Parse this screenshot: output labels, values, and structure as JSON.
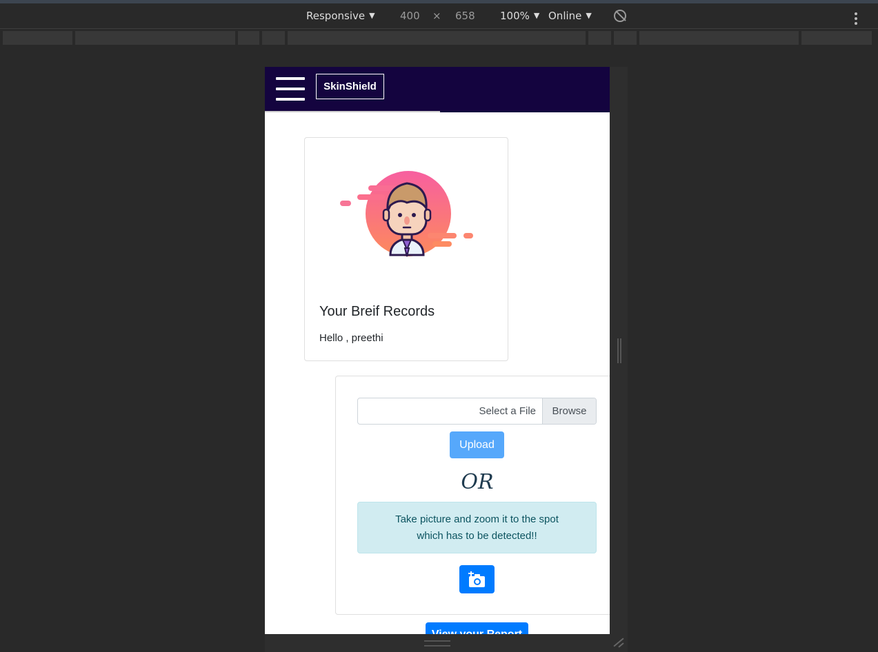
{
  "devtools": {
    "device": "Responsive",
    "width": "400",
    "times": "×",
    "height": "658",
    "zoom": "100%",
    "network": "Online",
    "icons": [
      "rotate-icon",
      "kebab-icon"
    ]
  },
  "app": {
    "brand": "SkinShield",
    "nav_color": "#14043f"
  },
  "profile": {
    "title": "Your Breif Records",
    "greeting": "Hello , preethi"
  },
  "upload": {
    "file_label": "Select a File",
    "browse_label": "Browse",
    "upload_label": "Upload",
    "or_text": "OR",
    "tip_line1": "Take picture and zoom it to the spot",
    "tip_line2": "which has to be detected!!",
    "camera_icon": "add-camera-icon",
    "view_report_label": "View your Report",
    "accent": "#007bff"
  }
}
